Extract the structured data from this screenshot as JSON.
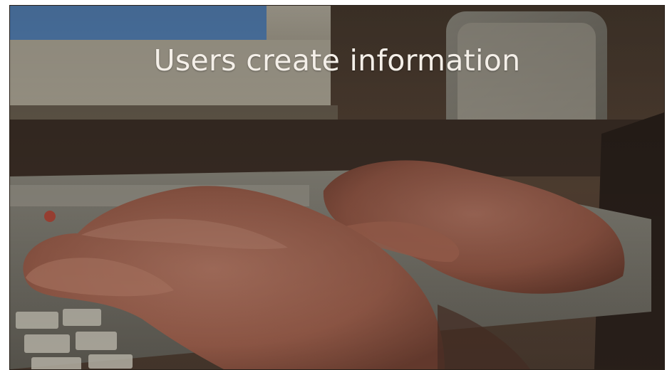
{
  "slide": {
    "title": "Users create information"
  },
  "photo": {
    "subject": "hands-typing-on-keyboard",
    "icon": "photo-icon"
  }
}
